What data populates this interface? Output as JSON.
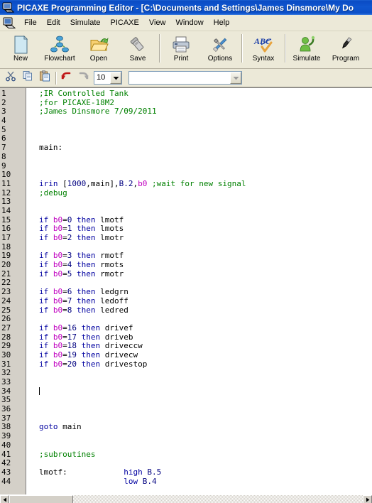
{
  "window": {
    "title": "PICAXE Programming Editor  - [C:\\Documents and Settings\\James Dinsmore\\My Do",
    "icon": "computer-icon"
  },
  "menubar": {
    "icon": "mdi-window-icon",
    "items": [
      {
        "label": "File"
      },
      {
        "label": "Edit"
      },
      {
        "label": "Simulate"
      },
      {
        "label": "PICAXE"
      },
      {
        "label": "View"
      },
      {
        "label": "Window"
      },
      {
        "label": "Help"
      }
    ]
  },
  "toolbar": {
    "buttons": [
      {
        "label": "New",
        "icon": "new-document-icon"
      },
      {
        "label": "Flowchart",
        "icon": "flowchart-icon"
      },
      {
        "label": "Open",
        "icon": "open-folder-icon"
      },
      {
        "label": "Save",
        "icon": "save-disk-icon"
      },
      {
        "label": "Print",
        "icon": "printer-icon"
      },
      {
        "label": "Options",
        "icon": "tools-icon"
      },
      {
        "label": "Syntax",
        "icon": "abc-check-icon"
      },
      {
        "label": "Simulate",
        "icon": "simulate-person-icon"
      },
      {
        "label": "Program",
        "icon": "program-pen-icon"
      }
    ]
  },
  "edit_toolbar": {
    "buttons": [
      {
        "label": "Cut",
        "icon": "scissors-icon"
      },
      {
        "label": "Copy",
        "icon": "copy-icon"
      },
      {
        "label": "Paste",
        "icon": "paste-icon"
      },
      {
        "label": "Undo",
        "icon": "undo-arrow-icon"
      },
      {
        "label": "Redo",
        "icon": "redo-arrow-icon"
      }
    ],
    "font_size": {
      "value": "10",
      "icon": "chevron-down-icon"
    },
    "font_name": {
      "value": "",
      "icon": "chevron-down-icon"
    }
  },
  "editor": {
    "lines": [
      {
        "n": "1",
        "tokens": [
          {
            "t": "comment",
            "s": ";IR Controlled Tank"
          }
        ]
      },
      {
        "n": "2",
        "tokens": [
          {
            "t": "comment",
            "s": ";for PICAXE-18M2"
          }
        ]
      },
      {
        "n": "3",
        "tokens": [
          {
            "t": "comment",
            "s": ";James Dinsmore 7/09/2011"
          }
        ]
      },
      {
        "n": "4",
        "tokens": []
      },
      {
        "n": "5",
        "tokens": []
      },
      {
        "n": "6",
        "tokens": []
      },
      {
        "n": "7",
        "tokens": [
          {
            "t": "plain",
            "s": "main:"
          }
        ]
      },
      {
        "n": "8",
        "tokens": []
      },
      {
        "n": "9",
        "tokens": []
      },
      {
        "n": "10",
        "tokens": []
      },
      {
        "n": "11",
        "tokens": [
          {
            "t": "kw",
            "s": "irin"
          },
          {
            "t": "plain",
            "s": " ["
          },
          {
            "t": "num",
            "s": "1000"
          },
          {
            "t": "plain",
            "s": ",main],"
          },
          {
            "t": "num",
            "s": "B.2"
          },
          {
            "t": "plain",
            "s": ","
          },
          {
            "t": "var",
            "s": "b0"
          },
          {
            "t": "plain",
            "s": " "
          },
          {
            "t": "comment",
            "s": ";wait for new signal"
          }
        ]
      },
      {
        "n": "12",
        "tokens": [
          {
            "t": "comment",
            "s": ";debug"
          }
        ]
      },
      {
        "n": "13",
        "tokens": []
      },
      {
        "n": "14",
        "tokens": []
      },
      {
        "n": "15",
        "tokens": [
          {
            "t": "kw",
            "s": "if "
          },
          {
            "t": "var",
            "s": "b0"
          },
          {
            "t": "plain",
            "s": "="
          },
          {
            "t": "num",
            "s": "0"
          },
          {
            "t": "kw",
            "s": " then "
          },
          {
            "t": "plain",
            "s": "lmotf"
          }
        ]
      },
      {
        "n": "16",
        "tokens": [
          {
            "t": "kw",
            "s": "if "
          },
          {
            "t": "var",
            "s": "b0"
          },
          {
            "t": "plain",
            "s": "="
          },
          {
            "t": "num",
            "s": "1"
          },
          {
            "t": "kw",
            "s": " then "
          },
          {
            "t": "plain",
            "s": "lmots"
          }
        ]
      },
      {
        "n": "17",
        "tokens": [
          {
            "t": "kw",
            "s": "if "
          },
          {
            "t": "var",
            "s": "b0"
          },
          {
            "t": "plain",
            "s": "="
          },
          {
            "t": "num",
            "s": "2"
          },
          {
            "t": "kw",
            "s": " then "
          },
          {
            "t": "plain",
            "s": "lmotr"
          }
        ]
      },
      {
        "n": "18",
        "tokens": []
      },
      {
        "n": "19",
        "tokens": [
          {
            "t": "kw",
            "s": "if "
          },
          {
            "t": "var",
            "s": "b0"
          },
          {
            "t": "plain",
            "s": "="
          },
          {
            "t": "num",
            "s": "3"
          },
          {
            "t": "kw",
            "s": " then "
          },
          {
            "t": "plain",
            "s": "rmotf"
          }
        ]
      },
      {
        "n": "20",
        "tokens": [
          {
            "t": "kw",
            "s": "if "
          },
          {
            "t": "var",
            "s": "b0"
          },
          {
            "t": "plain",
            "s": "="
          },
          {
            "t": "num",
            "s": "4"
          },
          {
            "t": "kw",
            "s": " then "
          },
          {
            "t": "plain",
            "s": "rmots"
          }
        ]
      },
      {
        "n": "21",
        "tokens": [
          {
            "t": "kw",
            "s": "if "
          },
          {
            "t": "var",
            "s": "b0"
          },
          {
            "t": "plain",
            "s": "="
          },
          {
            "t": "num",
            "s": "5"
          },
          {
            "t": "kw",
            "s": " then "
          },
          {
            "t": "plain",
            "s": "rmotr"
          }
        ]
      },
      {
        "n": "22",
        "tokens": []
      },
      {
        "n": "23",
        "tokens": [
          {
            "t": "kw",
            "s": "if "
          },
          {
            "t": "var",
            "s": "b0"
          },
          {
            "t": "plain",
            "s": "="
          },
          {
            "t": "num",
            "s": "6"
          },
          {
            "t": "kw",
            "s": " then "
          },
          {
            "t": "plain",
            "s": "ledgrn"
          }
        ]
      },
      {
        "n": "24",
        "tokens": [
          {
            "t": "kw",
            "s": "if "
          },
          {
            "t": "var",
            "s": "b0"
          },
          {
            "t": "plain",
            "s": "="
          },
          {
            "t": "num",
            "s": "7"
          },
          {
            "t": "kw",
            "s": " then "
          },
          {
            "t": "plain",
            "s": "ledoff"
          }
        ]
      },
      {
        "n": "25",
        "tokens": [
          {
            "t": "kw",
            "s": "if "
          },
          {
            "t": "var",
            "s": "b0"
          },
          {
            "t": "plain",
            "s": "="
          },
          {
            "t": "num",
            "s": "8"
          },
          {
            "t": "kw",
            "s": " then "
          },
          {
            "t": "plain",
            "s": "ledred"
          }
        ]
      },
      {
        "n": "26",
        "tokens": []
      },
      {
        "n": "27",
        "tokens": [
          {
            "t": "kw",
            "s": "if "
          },
          {
            "t": "var",
            "s": "b0"
          },
          {
            "t": "plain",
            "s": "="
          },
          {
            "t": "num",
            "s": "16"
          },
          {
            "t": "kw",
            "s": " then "
          },
          {
            "t": "plain",
            "s": "drivef"
          }
        ]
      },
      {
        "n": "28",
        "tokens": [
          {
            "t": "kw",
            "s": "if "
          },
          {
            "t": "var",
            "s": "b0"
          },
          {
            "t": "plain",
            "s": "="
          },
          {
            "t": "num",
            "s": "17"
          },
          {
            "t": "kw",
            "s": " then "
          },
          {
            "t": "plain",
            "s": "driveb"
          }
        ]
      },
      {
        "n": "29",
        "tokens": [
          {
            "t": "kw",
            "s": "if "
          },
          {
            "t": "var",
            "s": "b0"
          },
          {
            "t": "plain",
            "s": "="
          },
          {
            "t": "num",
            "s": "18"
          },
          {
            "t": "kw",
            "s": " then "
          },
          {
            "t": "plain",
            "s": "driveccw"
          }
        ]
      },
      {
        "n": "30",
        "tokens": [
          {
            "t": "kw",
            "s": "if "
          },
          {
            "t": "var",
            "s": "b0"
          },
          {
            "t": "plain",
            "s": "="
          },
          {
            "t": "num",
            "s": "19"
          },
          {
            "t": "kw",
            "s": " then "
          },
          {
            "t": "plain",
            "s": "drivecw"
          }
        ]
      },
      {
        "n": "31",
        "tokens": [
          {
            "t": "kw",
            "s": "if "
          },
          {
            "t": "var",
            "s": "b0"
          },
          {
            "t": "plain",
            "s": "="
          },
          {
            "t": "num",
            "s": "20"
          },
          {
            "t": "kw",
            "s": " then "
          },
          {
            "t": "plain",
            "s": "drivestop"
          }
        ]
      },
      {
        "n": "32",
        "tokens": []
      },
      {
        "n": "33",
        "tokens": []
      },
      {
        "n": "34",
        "tokens": [],
        "caret": true
      },
      {
        "n": "35",
        "tokens": []
      },
      {
        "n": "36",
        "tokens": []
      },
      {
        "n": "37",
        "tokens": []
      },
      {
        "n": "38",
        "tokens": [
          {
            "t": "kw",
            "s": "goto "
          },
          {
            "t": "plain",
            "s": "main"
          }
        ]
      },
      {
        "n": "39",
        "tokens": []
      },
      {
        "n": "40",
        "tokens": []
      },
      {
        "n": "41",
        "tokens": [
          {
            "t": "comment",
            "s": ";subroutines"
          }
        ]
      },
      {
        "n": "42",
        "tokens": []
      },
      {
        "n": "43",
        "tokens": [
          {
            "t": "plain",
            "s": "lmotf:            "
          },
          {
            "t": "kw",
            "s": "high "
          },
          {
            "t": "num",
            "s": "B.5"
          }
        ]
      },
      {
        "n": "44",
        "tokens": [
          {
            "t": "plain",
            "s": "                  "
          },
          {
            "t": "kw",
            "s": "low "
          },
          {
            "t": "num",
            "s": "B.4"
          }
        ]
      }
    ]
  },
  "scrollbar": {
    "left_arrow": "left-arrow-icon",
    "right_arrow": "right-arrow-icon"
  },
  "colors": {
    "titlebar": "#0A4BC4",
    "chrome": "#ECE9D8",
    "gutter": "#D4D0C8",
    "comment": "#008000",
    "keyword": "#0000A0",
    "variable": "#C000C0",
    "number": "#000080",
    "text": "#000000"
  }
}
